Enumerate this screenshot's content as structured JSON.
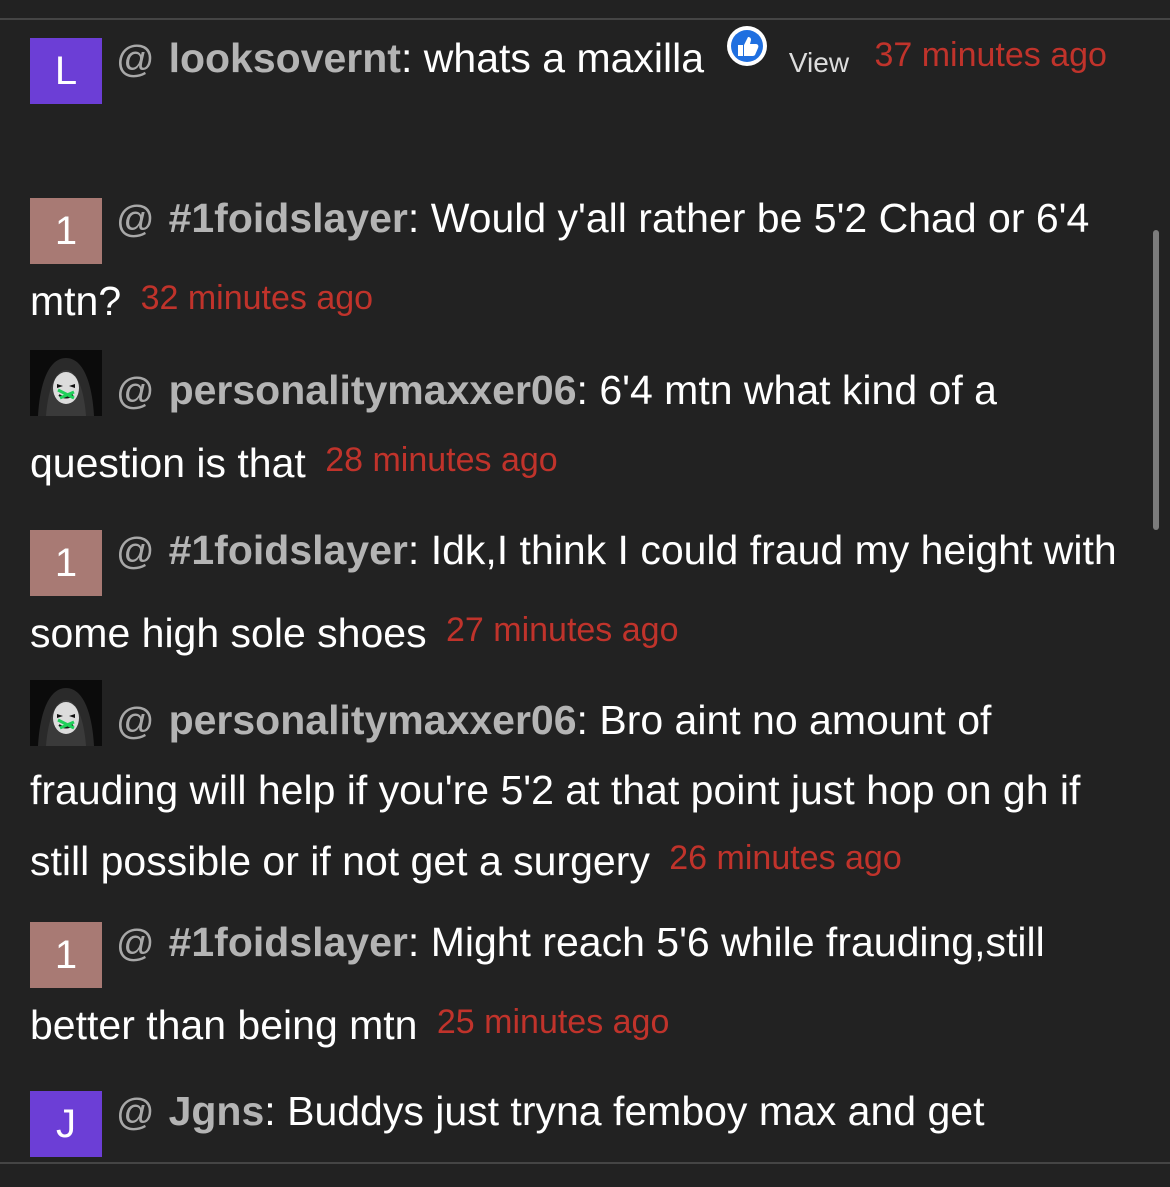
{
  "colors": {
    "background": "#222222",
    "username": "#b4b4b4",
    "timestamp": "#c0332b",
    "avatar_purple": "#6c3ed6",
    "avatar_mauve": "#a87a74"
  },
  "messages": [
    {
      "avatar_letter": "L",
      "avatar_color": "#6c3ed6",
      "at": "@",
      "username": "looksovernt",
      "separator": ":",
      "text": "whats a maxilla",
      "view_label": "View",
      "timestamp": "37 minutes ago"
    },
    {
      "avatar_letter": "1",
      "avatar_color": "#a87a74",
      "at": "@",
      "username": "#1foidslayer",
      "separator": ":",
      "text": "Would y'all rather be 5'2 Chad or 6'4 mtn?",
      "timestamp": "32 minutes ago"
    },
    {
      "avatar_icon": "masked-hacker-avatar",
      "at": "@",
      "username": "personalitymaxxer06",
      "separator": ":",
      "text": "6'4 mtn what kind of a question is that",
      "timestamp": "28 minutes ago"
    },
    {
      "avatar_letter": "1",
      "avatar_color": "#a87a74",
      "at": "@",
      "username": "#1foidslayer",
      "separator": ":",
      "text": "Idk,I think I could fraud my height with some high sole shoes",
      "timestamp": "27 minutes ago"
    },
    {
      "avatar_icon": "masked-hacker-avatar",
      "at": "@",
      "username": "personalitymaxxer06",
      "separator": ":",
      "text": "Bro aint no amount of frauding will help if you're 5'2 at that point just hop on gh if still possible or if not get a surgery",
      "timestamp": "26 minutes ago"
    },
    {
      "avatar_letter": "1",
      "avatar_color": "#a87a74",
      "at": "@",
      "username": "#1foidslayer",
      "separator": ":",
      "text": "Might reach 5'6 while frauding,still better than being mtn",
      "timestamp": "25 minutes ago"
    },
    {
      "avatar_letter": "J",
      "avatar_color": "#6c3ed6",
      "at": "@",
      "username": "Jgns",
      "separator": ":",
      "text": "Buddys just tryna femboy max and get",
      "timestamp": ""
    }
  ]
}
